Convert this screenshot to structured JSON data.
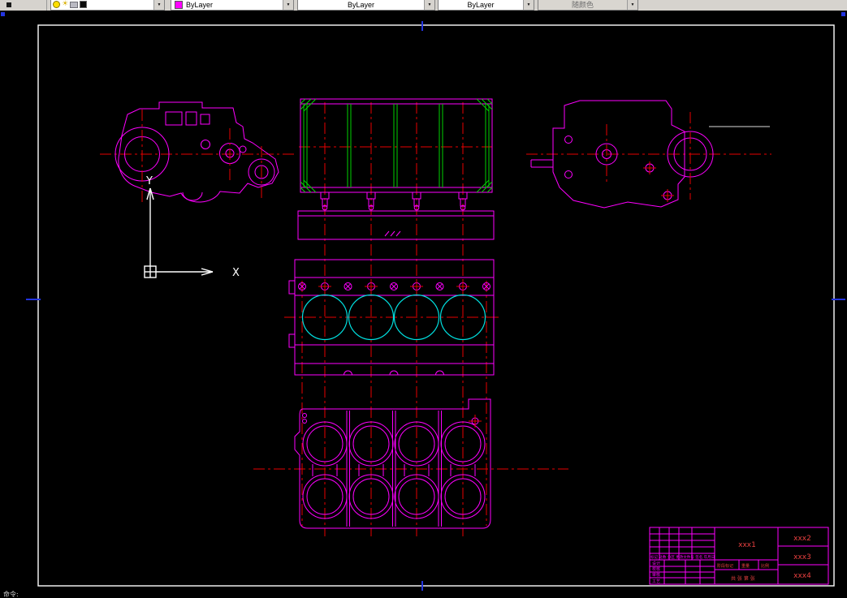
{
  "toolbar": {
    "color_value": "ByLayer",
    "linetype_value": "ByLayer",
    "lineweight_value": "ByLayer",
    "plotstyle_value": "随颜色",
    "dropdown_glyph": "▼",
    "sun_glyph": "☀"
  },
  "canvas": {
    "command_prompt": "命令:"
  },
  "ucs": {
    "x_label": "X",
    "y_label": "Y"
  },
  "title_block": {
    "drawing_no": "xxx1",
    "field_top": "xxx2",
    "field_mid": "xxx3",
    "field_bottom": "xxx4",
    "rev_header": "标记 处数 分区 更改文件号 签名 年月日",
    "row_design": "设计",
    "row_check": "校核",
    "row_review": "审核",
    "row_process": "工艺",
    "col_stage": "阶段标记",
    "col_weight": "重量",
    "col_scale": "比例",
    "sheet_info": "共 张 第 张"
  },
  "colors": {
    "outline_magenta": "#ff00ff",
    "centerline_red": "#e80000",
    "bore_cyan": "#00e0e0",
    "hatch_green": "#00d200",
    "sheet_white": "#ffffff",
    "layout_blue": "#2334e0",
    "toolbar_gray": "#d6d3ce"
  }
}
